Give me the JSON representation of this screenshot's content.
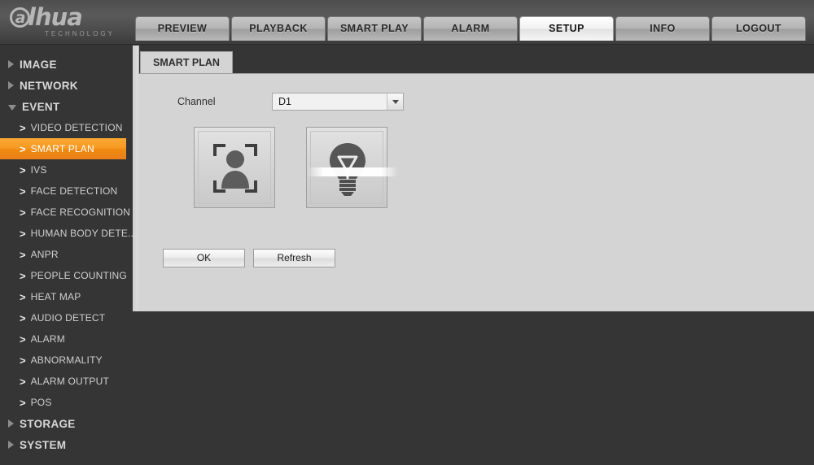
{
  "header": {
    "logo_text": "alhua",
    "logo_initial": "a",
    "logo_rest": "lhua",
    "logo_subtitle": "TECHNOLOGY",
    "tabs": [
      {
        "label": "PREVIEW",
        "active": false
      },
      {
        "label": "PLAYBACK",
        "active": false
      },
      {
        "label": "SMART PLAY",
        "active": false
      },
      {
        "label": "ALARM",
        "active": false
      },
      {
        "label": "SETUP",
        "active": true
      },
      {
        "label": "INFO",
        "active": false
      },
      {
        "label": "LOGOUT",
        "active": false
      }
    ]
  },
  "sidebar": {
    "groups": [
      {
        "label": "IMAGE",
        "expanded": false
      },
      {
        "label": "NETWORK",
        "expanded": false
      },
      {
        "label": "EVENT",
        "expanded": true
      }
    ],
    "event_items": [
      {
        "label": "VIDEO DETECTION",
        "selected": false
      },
      {
        "label": "SMART PLAN",
        "selected": true
      },
      {
        "label": "IVS",
        "selected": false
      },
      {
        "label": "FACE DETECTION",
        "selected": false
      },
      {
        "label": "FACE RECOGNITION",
        "selected": false
      },
      {
        "label": "HUMAN BODY DETE...",
        "selected": false
      },
      {
        "label": "ANPR",
        "selected": false
      },
      {
        "label": "PEOPLE COUNTING",
        "selected": false
      },
      {
        "label": "HEAT MAP",
        "selected": false
      },
      {
        "label": "AUDIO DETECT",
        "selected": false
      },
      {
        "label": "ALARM",
        "selected": false
      },
      {
        "label": "ABNORMALITY",
        "selected": false
      },
      {
        "label": "ALARM OUTPUT",
        "selected": false
      },
      {
        "label": "POS",
        "selected": false
      }
    ],
    "tail_groups": [
      {
        "label": "STORAGE",
        "expanded": false
      },
      {
        "label": "SYSTEM",
        "expanded": false
      }
    ],
    "chevron": ">",
    "accent_color": "#f39a1f",
    "background_color": "#353535"
  },
  "content": {
    "tab_title": "SMART PLAN",
    "channel_label": "Channel",
    "channel_value": "D1",
    "channel_options": [
      "D1"
    ],
    "modes": [
      {
        "name": "face-detection-mode",
        "icon": "person-in-frame-icon",
        "selected": false,
        "disabled": false
      },
      {
        "name": "smart-light-mode",
        "icon": "light-bulb-icon",
        "selected": false,
        "disabled": true
      }
    ],
    "buttons": [
      {
        "label": "OK",
        "name": "ok-button"
      },
      {
        "label": "Refresh",
        "name": "refresh-button"
      }
    ],
    "panel_background": "#d4d4d4"
  }
}
